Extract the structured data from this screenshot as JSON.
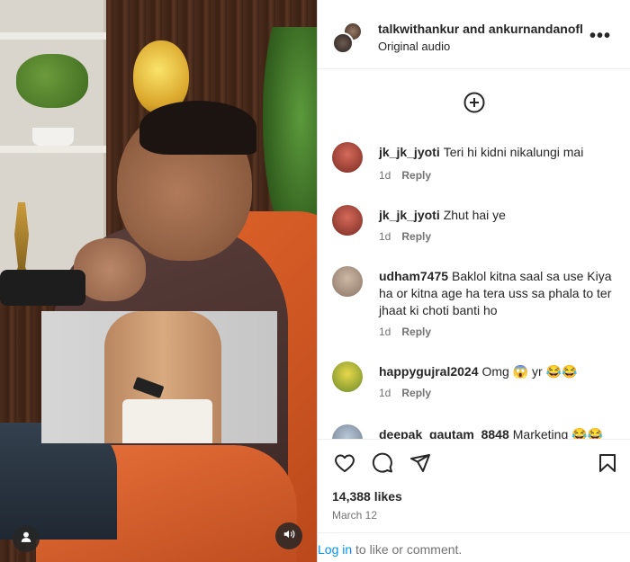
{
  "post": {
    "author": "talkwithankur and ankurnandanofl",
    "audio": "Original audio",
    "more_label": "•••",
    "add_comment_label": "+",
    "likes": "14,388 likes",
    "date": "March 12"
  },
  "comments": [
    {
      "user": "jk_jk_jyoti",
      "text": "Teri hi kidni nikalungi mai",
      "time": "1d",
      "reply": "Reply"
    },
    {
      "user": "jk_jk_jyoti",
      "text": "Zhut hai ye",
      "time": "1d",
      "reply": "Reply"
    },
    {
      "user": "udham7475",
      "text": "Baklol kitna saal sa use Kiya ha or kitna age ha tera uss sa phala to ter jhaat ki choti banti ho",
      "time": "1d",
      "reply": "Reply"
    },
    {
      "user": "happygujral2024",
      "text": "Omg 😱 yr 😂😂",
      "time": "1d",
      "reply": "Reply"
    },
    {
      "user": "deepak_gautam_8848",
      "text": "Marketing 😂😂",
      "time": "",
      "reply": ""
    }
  ],
  "footer": {
    "login_link": "Log in",
    "login_rest": " to like or comment."
  },
  "icons": {
    "like": "heart-icon",
    "comment": "comment-icon",
    "share": "share-icon",
    "save": "bookmark-icon",
    "user": "user-icon",
    "audio": "speaker-icon"
  },
  "colors": {
    "link": "#0095f6",
    "muted": "#737373",
    "text": "#262626"
  }
}
